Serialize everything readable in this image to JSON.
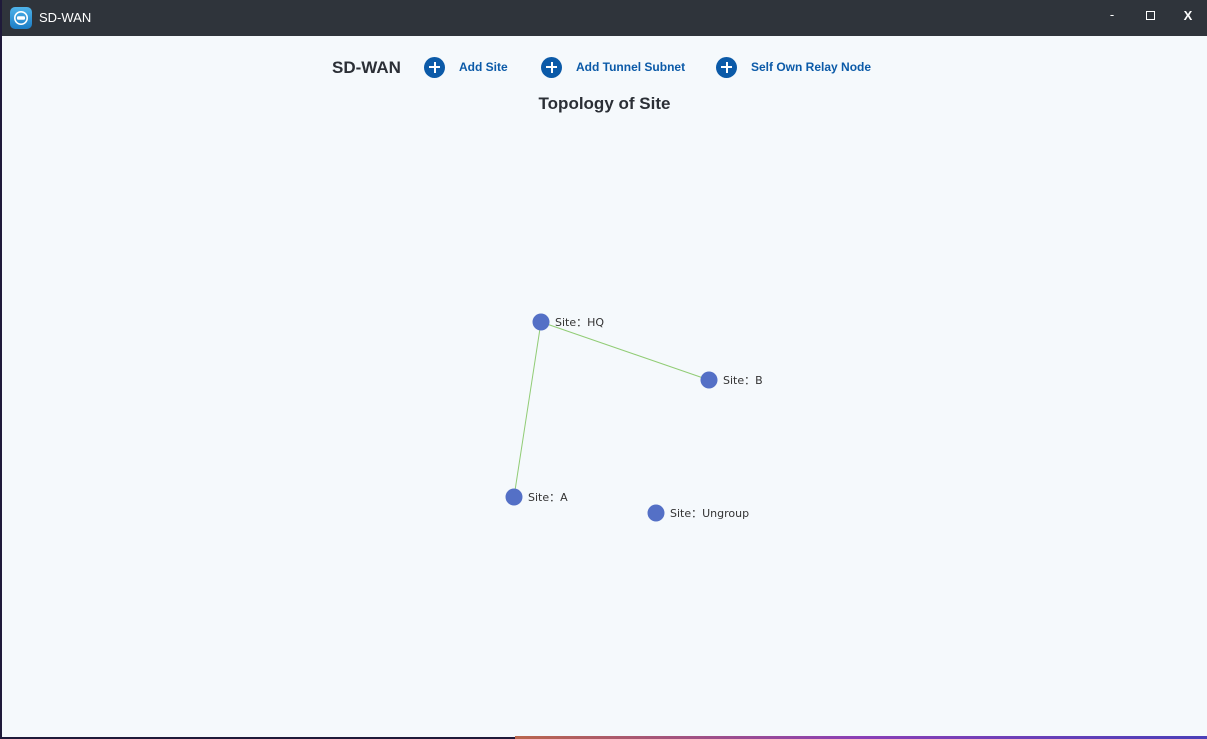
{
  "window": {
    "title": "SD-WAN",
    "controls": {
      "minimize": "-",
      "close": "X"
    }
  },
  "toolbar": {
    "brand": "SD-WAN",
    "actions": [
      {
        "label": "Add Site",
        "icon": "plus-circle-icon"
      },
      {
        "label": "Add Tunnel Subnet",
        "icon": "plus-circle-icon"
      },
      {
        "label": "Self Own Relay Node",
        "icon": "plus-circle-icon"
      }
    ]
  },
  "topology": {
    "title": "Topology of Site",
    "nodes": [
      {
        "id": "hq",
        "label": "Site：HQ"
      },
      {
        "id": "b",
        "label": "Site：B"
      },
      {
        "id": "a",
        "label": "Site：A"
      },
      {
        "id": "ungroup",
        "label": "Site：Ungroup"
      }
    ],
    "links": [
      {
        "from": "hq",
        "to": "b"
      },
      {
        "from": "hq",
        "to": "a"
      }
    ]
  },
  "colors": {
    "titlebar": "#2f343b",
    "accent": "#0b5aa8",
    "node": "#5470c6",
    "link": "#91cc75",
    "background": "#f5f9fc"
  }
}
